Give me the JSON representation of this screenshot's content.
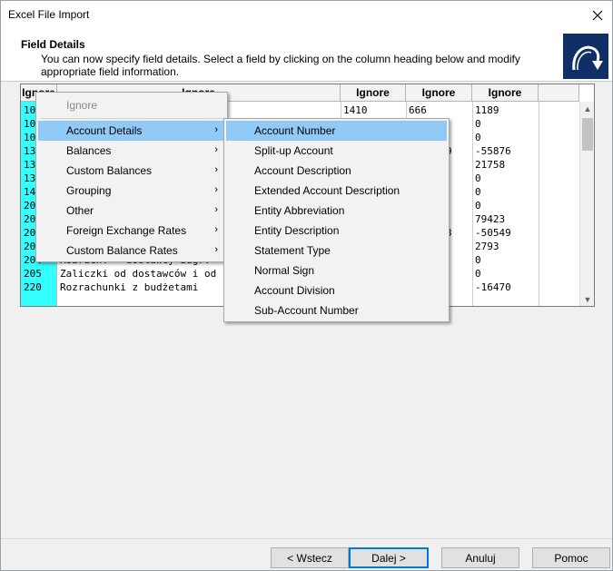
{
  "window": {
    "title": "Excel File Import"
  },
  "header": {
    "title": "Field Details",
    "description": "You can now specify field details. Select a field by clicking on the column heading below and modify appropriate field information."
  },
  "grid": {
    "headers": [
      "Ignore",
      "Ignore",
      "Ignore",
      "Ignore",
      "Ignore"
    ],
    "col0": [
      "10",
      "10",
      "10",
      "13",
      "13",
      "13",
      "14",
      "20",
      "20",
      "20",
      "20",
      "204",
      "205",
      "220"
    ],
    "col1_visible": [
      {
        "row": 11,
        "text": "Rozrach. - dostawcy zagr."
      },
      {
        "row": 12,
        "text": "Zaliczki od dostawców i od"
      },
      {
        "row": 13,
        "text": "Rozrachunki z budżetami"
      }
    ],
    "col2_visible": [
      {
        "row": 0,
        "text": "1410"
      }
    ],
    "col3_visible": [
      {
        "row": 0,
        "text": "666"
      },
      {
        "row": 3,
        "text": "9"
      },
      {
        "row": 9,
        "text": "3"
      }
    ],
    "col4": [
      "1189",
      "0",
      "0",
      "-55876",
      "21758",
      "0",
      "0",
      "0",
      "79423",
      "-50549",
      "2793",
      "0",
      "0",
      "-16470"
    ]
  },
  "menu1": {
    "items": [
      {
        "label": "Ignore",
        "disabled": true,
        "submenu": false
      },
      {
        "label": "Account Details",
        "submenu": true,
        "highlight": true
      },
      {
        "label": "Balances",
        "submenu": true
      },
      {
        "label": "Custom Balances",
        "submenu": true
      },
      {
        "label": "Grouping",
        "submenu": true
      },
      {
        "label": "Other",
        "submenu": true
      },
      {
        "label": "Foreign Exchange Rates",
        "submenu": true
      },
      {
        "label": "Custom Balance Rates",
        "submenu": true
      }
    ]
  },
  "menu2": {
    "items": [
      {
        "label": "Account Number",
        "highlight": true
      },
      {
        "label": "Split-up Account"
      },
      {
        "label": "Account Description"
      },
      {
        "label": "Extended Account Description"
      },
      {
        "label": "Entity Abbreviation"
      },
      {
        "label": "Entity Description"
      },
      {
        "label": "Statement Type"
      },
      {
        "label": "Normal Sign"
      },
      {
        "label": "Account Division"
      },
      {
        "label": "Sub-Account Number"
      }
    ]
  },
  "buttons": {
    "back": "< Wstecz",
    "next": "Dalej >",
    "cancel": "Anuluj",
    "help": "Pomoc"
  },
  "colors": {
    "cyan": "#33ffff",
    "highlight": "#91c9f7",
    "logo": "#0f2f66",
    "focus": "#0078d7"
  }
}
